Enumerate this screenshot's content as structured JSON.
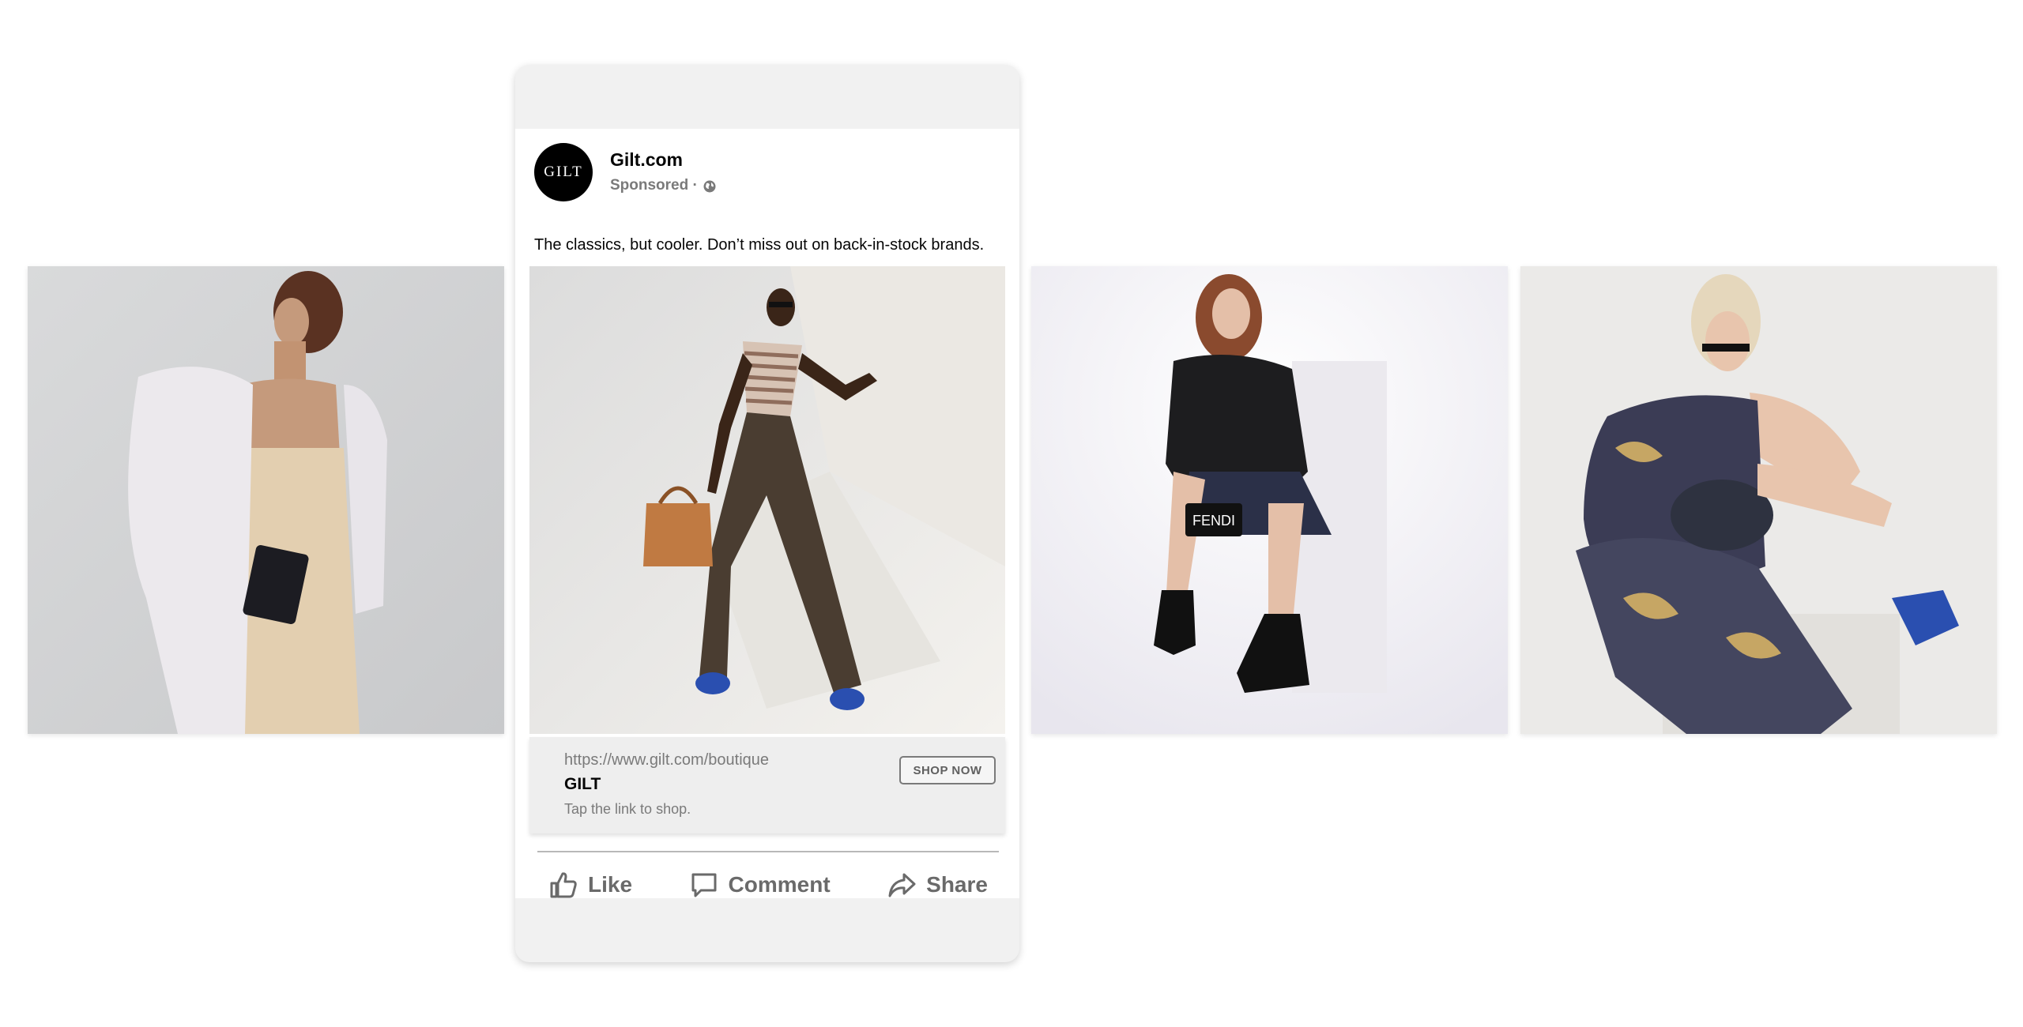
{
  "advertiser": {
    "name": "Gilt.com",
    "logo_text": "GILT",
    "sponsored_label": "Sponsored ·"
  },
  "post": {
    "primary_text": "The classics, but cooler. Don’t miss out on back-in-stock brands."
  },
  "link_card": {
    "url": "https://www.gilt.com/boutique",
    "title": "GILT",
    "description": "Tap the link to shop.",
    "cta_label": "SHOP NOW"
  },
  "actions": {
    "like": "Like",
    "comment": "Comment",
    "share": "Share"
  },
  "carousel": {
    "images": [
      {
        "name": "model-white-blazer-clutch"
      },
      {
        "name": "model-striped-top-brown-bag"
      },
      {
        "name": "model-leather-jacket-fendi-bag"
      },
      {
        "name": "model-paisley-outfit-saddle-bag"
      }
    ]
  },
  "icons": {
    "globe": "globe-icon",
    "like": "thumbs-up-icon",
    "comment": "comment-bubble-icon",
    "share": "share-arrow-icon"
  },
  "colors": {
    "background": "#ffffff",
    "phone_frame": "#f1f1f1",
    "text_primary": "#050505",
    "text_secondary": "#7a7a7a",
    "link_card_bg": "#eeeeee"
  }
}
